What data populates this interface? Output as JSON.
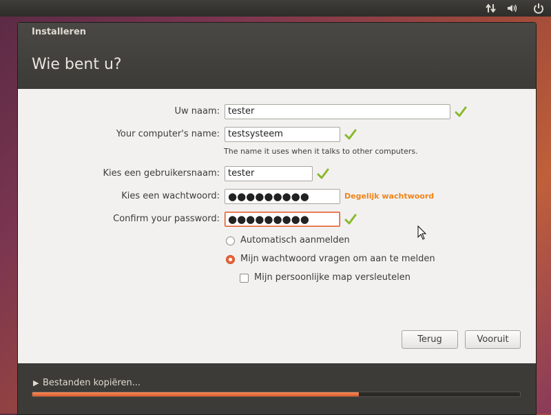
{
  "window": {
    "title": "Installeren",
    "page_title": "Wie bent u?"
  },
  "form": {
    "name_label": "Uw naam:",
    "name_value": "tester",
    "computer_label": "Your computer's name:",
    "computer_value": "testsysteem",
    "computer_hint": "The name it uses when it talks to other computers.",
    "username_label": "Kies een gebruikersnaam:",
    "username_value": "tester",
    "password_label": "Kies een wachtwoord:",
    "password_dots": "●●●●●●●●●",
    "password_strength": "Degelijk wachtwoord",
    "confirm_label": "Confirm your password:",
    "confirm_dots": "●●●●●●●●●",
    "auto_login_label": "Automatisch aanmelden",
    "ask_password_label": "Mijn wachtwoord vragen om aan te melden",
    "encrypt_home_label": "Mijn persoonlijke map versleutelen",
    "selected_login_option": "ask_password",
    "encrypt_home_checked": false
  },
  "buttons": {
    "back": "Terug",
    "forward": "Vooruit"
  },
  "footer": {
    "status": "Bestanden kopiëren...",
    "progress_fraction": 0.67
  },
  "colors": {
    "accent": "#dd5a2a",
    "strength_text": "#f08318",
    "header_bg": "#3c3b37",
    "check_green": "#8ab82a"
  },
  "icons": {
    "panel": [
      "network-updown-icon",
      "volume-icon",
      "power-icon"
    ],
    "valid": "checkmark-icon"
  }
}
